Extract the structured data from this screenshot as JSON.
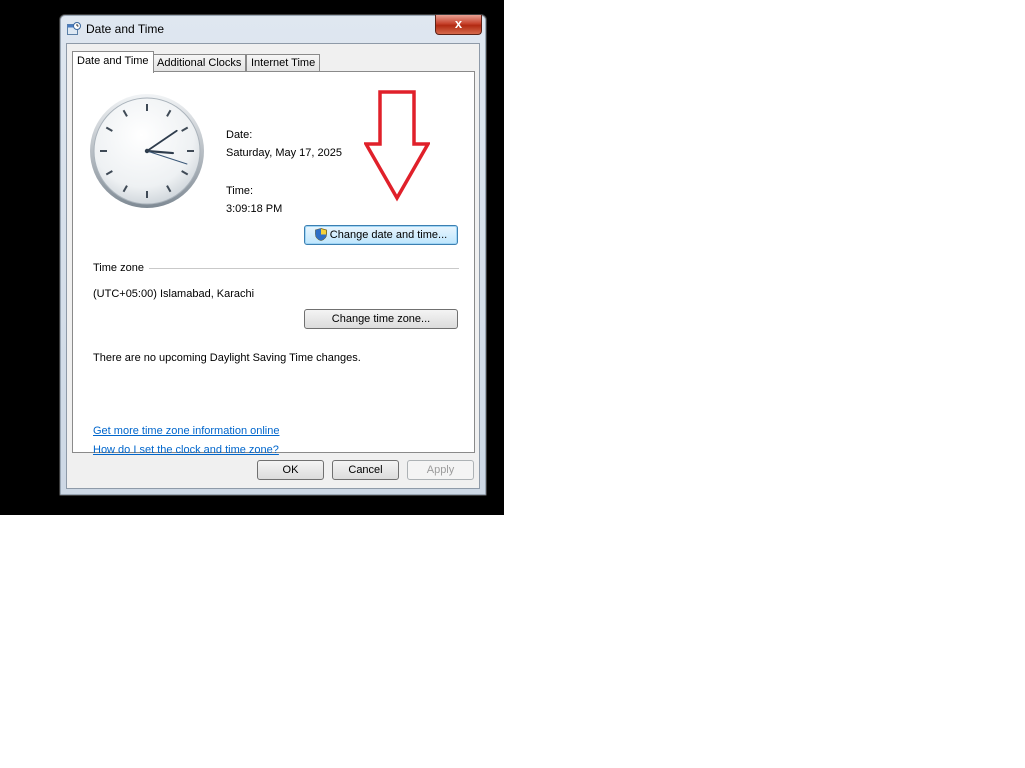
{
  "window": {
    "title": "Date and Time",
    "close_label": "x"
  },
  "tabs": [
    {
      "label": "Date and Time"
    },
    {
      "label": "Additional Clocks"
    },
    {
      "label": "Internet Time"
    }
  ],
  "date_time": {
    "date_label": "Date:",
    "date_value": "Saturday, May 17, 2025",
    "time_label": "Time:",
    "time_value": "3:09:18 PM",
    "change_button": "Change date and time..."
  },
  "clock": {
    "hour": 3,
    "minute": 9,
    "second": 18
  },
  "time_zone": {
    "header": "Time zone",
    "value": "(UTC+05:00) Islamabad, Karachi",
    "change_button": "Change time zone...",
    "dst_note": "There are no upcoming Daylight Saving Time changes."
  },
  "links": [
    {
      "label": "Get more time zone information online"
    },
    {
      "label": "How do I set the clock and time zone?"
    }
  ],
  "footer": {
    "ok": "OK",
    "cancel": "Cancel",
    "apply": "Apply"
  },
  "annotation": {
    "arrow_color": "#e0202a"
  }
}
